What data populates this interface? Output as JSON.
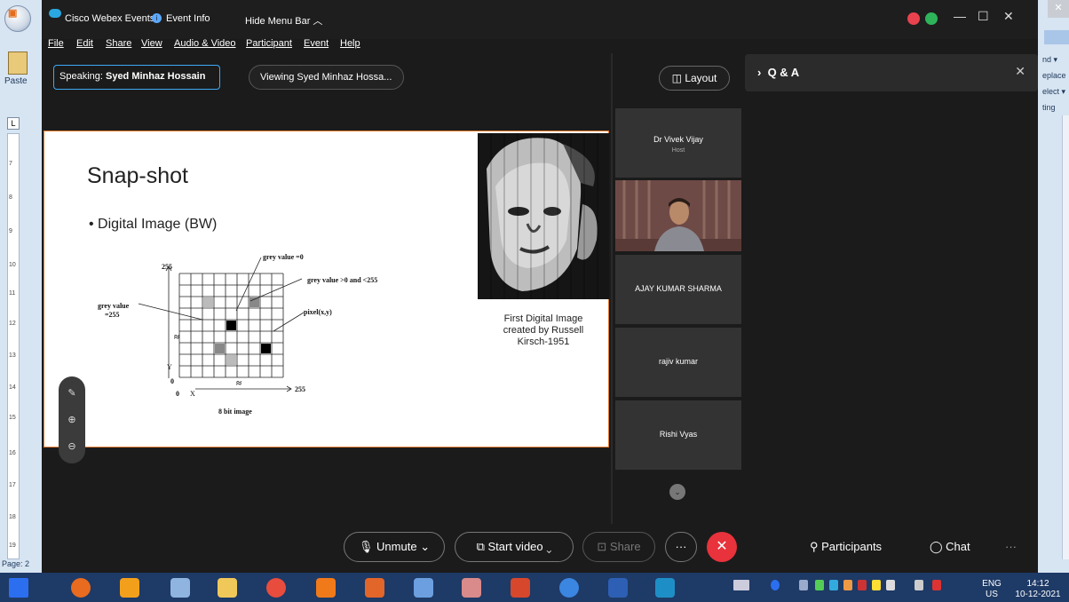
{
  "word": {
    "paste_label": "Paste",
    "page_label": "Page: 2",
    "ruler_marks": [
      "7",
      "8",
      "9",
      "10",
      "11",
      "12",
      "13",
      "14",
      "15",
      "16",
      "17",
      "18",
      "19"
    ],
    "right_items": [
      "nd ▾",
      "eplace",
      "elect ▾",
      "ting"
    ]
  },
  "webex": {
    "app_title": "Cisco Webex Events",
    "event_info": "Event Info",
    "hide_menu": "Hide Menu Bar ︿",
    "menu": [
      "File",
      "Edit",
      "Share",
      "View",
      "Audio & Video",
      "Participant",
      "Event",
      "Help"
    ],
    "speaking_prefix": "Speaking: ",
    "speaking_name": "Syed Minhaz Hossain",
    "viewing": "Viewing Syed Minhaz Hossa...",
    "layout_label": "Layout",
    "qa_label": "Q & A"
  },
  "slide": {
    "title": "Snap-shot",
    "bullet": "• Digital Image (BW)",
    "caption": "First Digital Image created by Russell Kirsch-1951",
    "diagram_labels": {
      "y_max": "255",
      "grey0": "grey value  =0",
      "grey_mid": "grey value >0 and <255",
      "grey255_a": "grey value",
      "grey255_b": "=255",
      "pixel": "pixel(x,y)",
      "y_axis": "Y",
      "origin_y": "0",
      "origin_x": "0",
      "x_axis": "X",
      "x_max": "255",
      "approx": "≈",
      "footer": "8 bit image"
    }
  },
  "participants": [
    {
      "name": "Dr Vivek Vijay",
      "role": "Host"
    },
    {
      "name": "AJAY KUMAR SHARMA"
    },
    {
      "name": "rajiv kumar"
    },
    {
      "name": "Rishi Vyas"
    }
  ],
  "controls": {
    "unmute": "Unmute",
    "start_video": "Start video",
    "share": "Share",
    "more": "···",
    "participants": "Participants",
    "chat": "Chat",
    "overflow": "···"
  },
  "taskbar": {
    "lang": "ENG",
    "region": "US",
    "time": "14:12",
    "date": "10-12-2021"
  },
  "colors": {
    "accent": "#3fa9f5",
    "end_call": "#e8323c",
    "taskbar": "#1e3a66"
  }
}
